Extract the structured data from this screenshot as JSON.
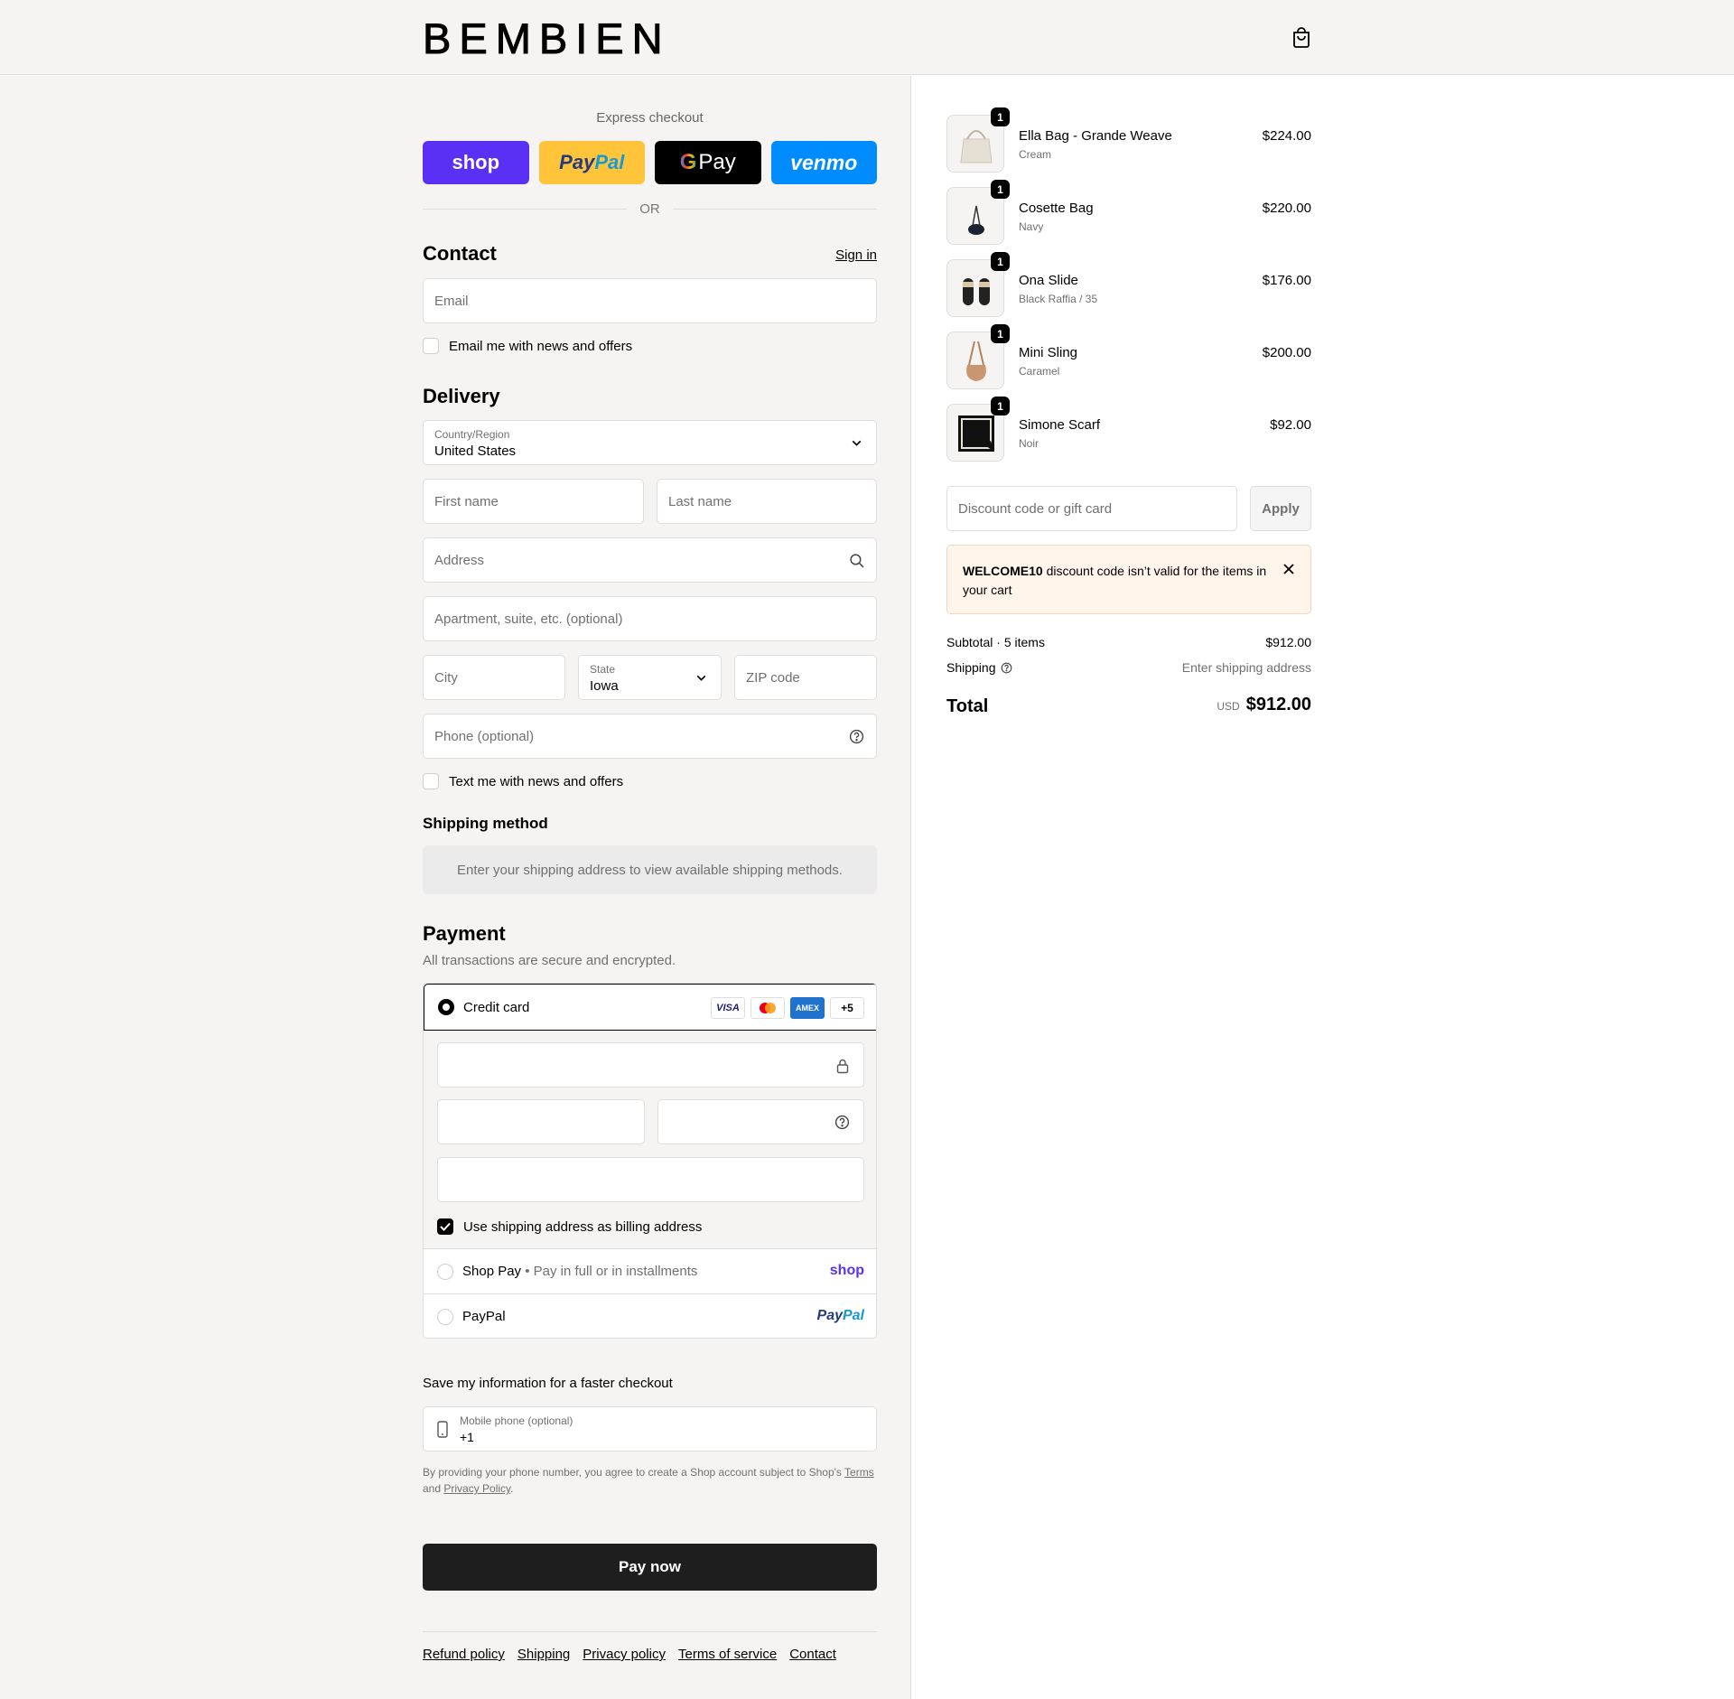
{
  "header": {
    "logo": "BEMBIEN",
    "cart_icon": "shopping-bag-icon"
  },
  "express": {
    "title": "Express checkout",
    "buttons": {
      "shop": "shop",
      "paypal_a": "Pay",
      "paypal_b": "Pal",
      "gpay_g": "G",
      "gpay": "Pay",
      "venmo": "venmo"
    },
    "or": "OR"
  },
  "contact": {
    "title": "Contact",
    "sign_in": "Sign in",
    "email_placeholder": "Email",
    "news_label": "Email me with news and offers"
  },
  "delivery": {
    "title": "Delivery",
    "country_label": "Country/Region",
    "country_value": "United States",
    "first_name": "First name",
    "last_name": "Last name",
    "address": "Address",
    "apartment": "Apartment, suite, etc. (optional)",
    "city": "City",
    "state_label": "State",
    "state_value": "Iowa",
    "zip": "ZIP code",
    "phone": "Phone (optional)",
    "text_label": "Text me with news and offers"
  },
  "shipping_method": {
    "title": "Shipping method",
    "message": "Enter your shipping address to view available shipping methods."
  },
  "payment": {
    "title": "Payment",
    "subtitle": "All transactions are secure and encrypted.",
    "credit_card": "Credit card",
    "brands": {
      "visa": "VISA",
      "amex": "AMEX",
      "more": "+5"
    },
    "billing_label": "Use shipping address as billing address",
    "shop_pay": "Shop Pay",
    "shop_pay_sub": "Pay in full or in installments",
    "shop_pay_logo": "shop",
    "paypal": "PayPal",
    "paypal_logo_a": "Pay",
    "paypal_logo_b": "Pal"
  },
  "save_info": {
    "title": "Save my information for a faster checkout",
    "mobile_label": "Mobile phone (optional)",
    "mobile_value": "+1",
    "legal_pre": "By providing your phone number, you agree to create a Shop account subject to Shop's ",
    "legal_terms": "Terms",
    "legal_and": "and ",
    "legal_privacy": "Privacy Policy",
    "legal_end": "."
  },
  "pay_now": "Pay now",
  "footer": [
    "Refund policy",
    "Shipping",
    "Privacy policy",
    "Terms of service",
    "Contact"
  ],
  "items": [
    {
      "name": "Ella Bag - Grande Weave",
      "variant": "Cream",
      "price": "$224.00",
      "qty": "1"
    },
    {
      "name": "Cosette Bag",
      "variant": "Navy",
      "price": "$220.00",
      "qty": "1"
    },
    {
      "name": "Ona Slide",
      "variant": "Black Raffia / 35",
      "price": "$176.00",
      "qty": "1"
    },
    {
      "name": "Mini Sling",
      "variant": "Caramel",
      "price": "$200.00",
      "qty": "1"
    },
    {
      "name": "Simone Scarf",
      "variant": "Noir",
      "price": "$92.00",
      "qty": "1"
    }
  ],
  "discount": {
    "placeholder": "Discount code or gift card",
    "apply": "Apply"
  },
  "warning": {
    "code": "WELCOME10",
    "message": " discount code isn’t valid for the items in your cart"
  },
  "summary": {
    "subtotal_label": "Subtotal · 5 items",
    "subtotal_value": "$912.00",
    "shipping_label": "Shipping",
    "shipping_value": "Enter shipping address",
    "total_label": "Total",
    "currency": "USD",
    "total_value": "$912.00"
  },
  "colors": {
    "shop": "#5a31f4",
    "paypal": "#ffc439",
    "venmo": "#008cff",
    "button": "#1e1e1e"
  }
}
